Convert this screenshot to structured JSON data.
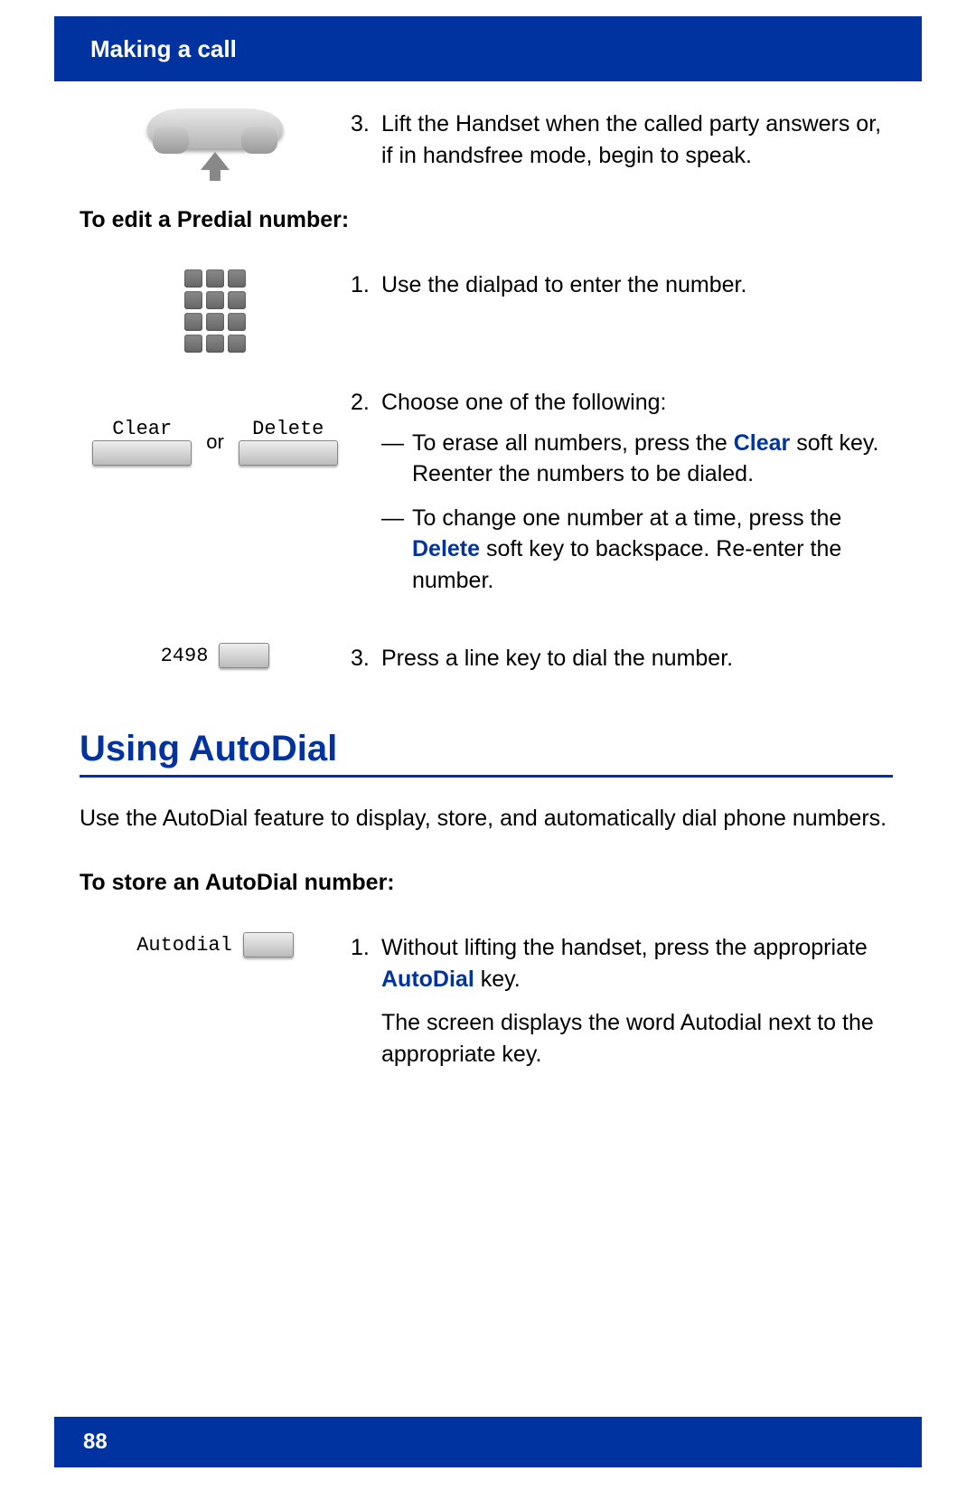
{
  "header": {
    "title": "Making a call"
  },
  "step3_top": {
    "num": "3.",
    "text": "Lift the Handset when the called party answers or, if in handsfree mode, begin to speak."
  },
  "predial": {
    "heading": "To edit a Predial number:",
    "step1": {
      "num": "1.",
      "text": "Use the dialpad to enter the number."
    },
    "step2": {
      "num": "2.",
      "lead": "Choose one of the following:",
      "bullet1_pre": "To erase all numbers, press the ",
      "bullet1_key": "Clear",
      "bullet1_post": " soft key. Reenter the numbers to be dialed.",
      "bullet2_pre": "To change one number at a time, press the ",
      "bullet2_key": "Delete",
      "bullet2_post": " soft key to backspace. Re-enter the number."
    },
    "step3": {
      "num": "3.",
      "text": "Press a line key to dial the number."
    },
    "softkeys": {
      "clear": "Clear",
      "delete": "Delete",
      "or": "or"
    },
    "line_number": "2498"
  },
  "autodial": {
    "section_title": "Using AutoDial",
    "intro": "Use the AutoDial feature to display, store, and automatically dial phone numbers.",
    "heading": "To store an AutoDial number:",
    "line_label": "Autodial",
    "step1": {
      "num": "1.",
      "pre": "Without lifting the handset, press the appropriate ",
      "key": "AutoDial",
      "post": " key.",
      "follow": "The screen displays the word Autodial next to the appropriate key."
    }
  },
  "footer": {
    "page": "88"
  }
}
